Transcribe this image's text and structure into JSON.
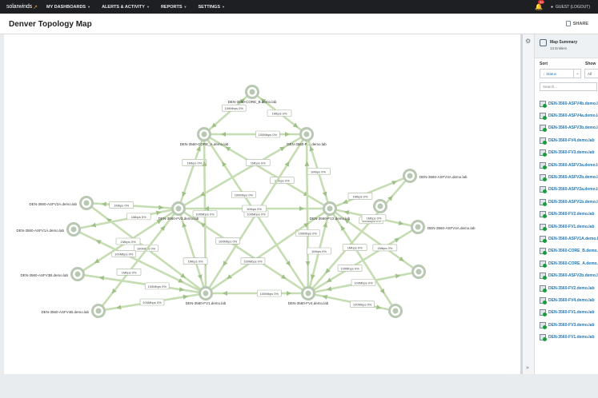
{
  "app": {
    "logo_text": "solarwinds",
    "logo_mark": "↗"
  },
  "nav": [
    {
      "label": "MY DASHBOARDS"
    },
    {
      "label": "ALERTS & ACTIVITY"
    },
    {
      "label": "REPORTS"
    },
    {
      "label": "SETTINGS"
    }
  ],
  "topright": {
    "bell_icon": "bell-icon",
    "alert_count": "99",
    "user_label": "GUEST (LOGOUT)"
  },
  "page": {
    "title": "Denver Topology Map",
    "share_label": "SHARE"
  },
  "map": {
    "link_color": "#c6ddb3",
    "node_color": "#b8c8b2",
    "nodes": [
      {
        "id": "core_b",
        "label": "DEN-3560-CORE_B.demo.lab"
      },
      {
        "id": "core_a",
        "label": "DEN-3560-CORE_A.demo.lab"
      },
      {
        "id": "dist_top",
        "label": "DEN-3560-F… demo.lab"
      },
      {
        "id": "fv3",
        "label": "DEN-3560-FV3.demo.lab"
      },
      {
        "id": "fv1",
        "label": "DEN-3560-FV1.demo.lab"
      },
      {
        "id": "fv4",
        "label": "DEN-3560-FV4.demo.lab"
      },
      {
        "id": "fv2",
        "label": "DEN-3560-FV2.demo.lab"
      },
      {
        "id": "asfv2a",
        "label": "DEN-3560-ASFV2A.demo.lab"
      },
      {
        "id": "asfv1a",
        "label": "DEN-3560-ASFV1A.demo.lab"
      },
      {
        "id": "asfv3b",
        "label": "DEN-3560-ASFV3B.demo.lab"
      },
      {
        "id": "asfv4b",
        "label": "DEN-3560-ASFV4B.demo.lab"
      },
      {
        "id": "asfv3a",
        "label": "DEN-3560-ASFV3A.demo.lab"
      },
      {
        "id": "asfv4a",
        "label": "DEN-3560-ASFV4A.demo.lab"
      }
    ],
    "link_label_short": "1Mbps 0%",
    "link_label_long": "100Mbps 0%"
  },
  "rail": {
    "gear_icon": "gear-icon",
    "collapse_icon": "double-chevron-right-icon"
  },
  "panel": {
    "title": "Map Summary",
    "count": "13 Entities",
    "sort_label": "Sort",
    "sort_value": "Status",
    "show_label": "Show",
    "show_value": "All",
    "search_placeholder": "Search...",
    "items": [
      {
        "label": "DEN-3560-ASFV4b.demo.lab"
      },
      {
        "label": "DEN-3560-ASFV4a.demo.lab"
      },
      {
        "label": "DEN-3560-ASFV3b.demo.lab"
      },
      {
        "label": "DEN-3560-FV4.demo.lab"
      },
      {
        "label": "DEN-3560-FV3.demo.lab"
      },
      {
        "label": "DEN-3560-ASFV3a.demo.lab"
      },
      {
        "label": "DEN-3560-ASFV2b.demo.lab"
      },
      {
        "label": "DEN-3560-ASFV2a.demo.lab"
      },
      {
        "label": "DEN-3560-ASFV1b.demo.lab"
      },
      {
        "label": "DEN-3560-FV2.demo.lab"
      },
      {
        "label": "DEN-3560-FV1.demo.lab"
      },
      {
        "label": "DEN-3560-ASFV1A.demo.lab"
      },
      {
        "label": "DEN-3560-CORE_B.demo.lab"
      },
      {
        "label": "DEN-3560-CORE_A.demo.lab"
      },
      {
        "label": "DEN-3560-ASFV2b.demo.lab"
      },
      {
        "label": "DEN-3560-FV2.demo.lab"
      },
      {
        "label": "DEN-3560-FV4.demo.lab"
      },
      {
        "label": "DEN-3560-FV1.demo.lab"
      },
      {
        "label": "DEN-3560-FV3.demo.lab"
      },
      {
        "label": "DEN-3560-FV1.demo.lab"
      }
    ]
  }
}
